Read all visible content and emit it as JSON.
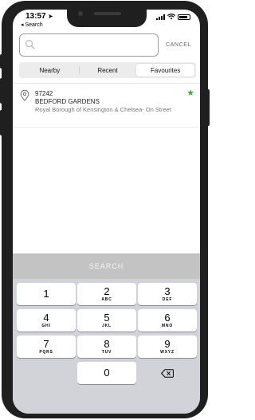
{
  "status_bar": {
    "time": "13:57",
    "back_label": "◂ Search"
  },
  "search": {
    "placeholder": "",
    "cancel_label": "CANCEL"
  },
  "tabs": [
    {
      "label": "Nearby",
      "active": false
    },
    {
      "label": "Recent",
      "active": false
    },
    {
      "label": "Favourites",
      "active": true
    }
  ],
  "results": [
    {
      "code": "97242",
      "name": "BEDFORD GARDENS",
      "area": "Royal Borough of Kensington & Chelsea- On Street",
      "favourite": true
    }
  ],
  "search_button_label": "SEARCH",
  "keypad": {
    "keys": [
      {
        "num": "1",
        "letters": ""
      },
      {
        "num": "2",
        "letters": "ABC"
      },
      {
        "num": "3",
        "letters": "DEF"
      },
      {
        "num": "4",
        "letters": "GHI"
      },
      {
        "num": "5",
        "letters": "JKL"
      },
      {
        "num": "6",
        "letters": "MNO"
      },
      {
        "num": "7",
        "letters": "PQRS"
      },
      {
        "num": "8",
        "letters": "TUV"
      },
      {
        "num": "9",
        "letters": "WXYZ"
      },
      {
        "num": "0",
        "letters": ""
      }
    ]
  },
  "colors": {
    "favourite_star": "#3cae3c",
    "search_bar": "#c3c3c3",
    "keypad_bg": "#d1d3d8"
  },
  "icons": {
    "search": "search-icon",
    "location": "map-pin-icon",
    "favourite": "star-icon",
    "delete": "backspace-icon"
  }
}
